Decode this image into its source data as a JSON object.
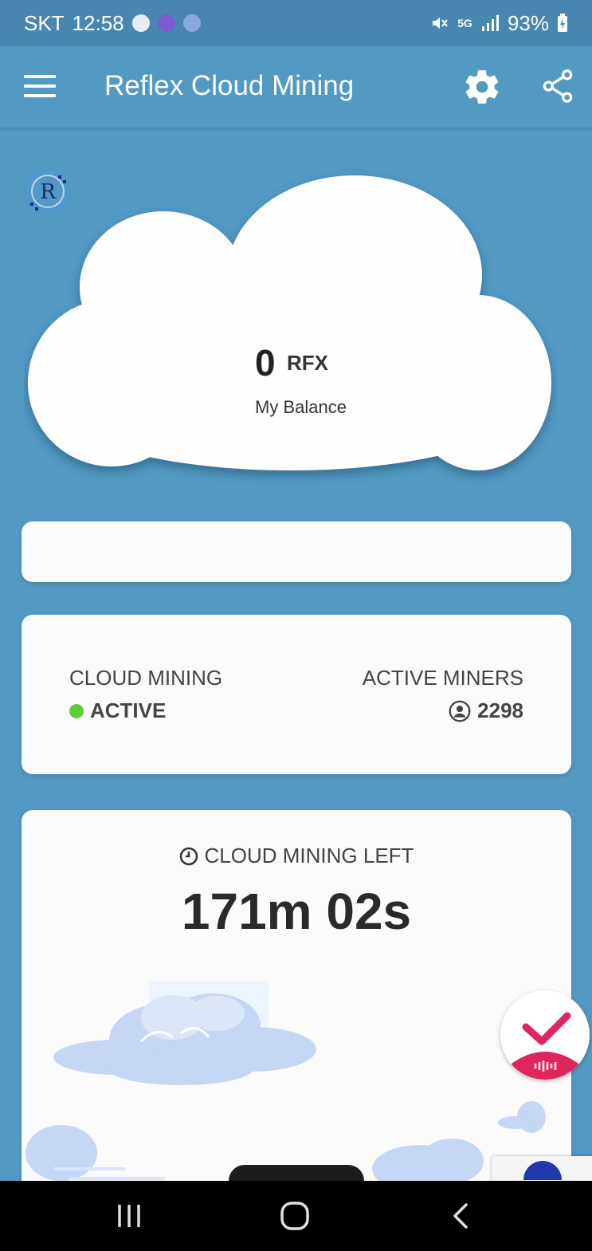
{
  "status_bar": {
    "carrier": "SKT",
    "time": "12:58",
    "battery": "93%",
    "network": "5G"
  },
  "app_bar": {
    "title": "Reflex Cloud Mining"
  },
  "balance": {
    "amount": "0",
    "unit": "RFX",
    "label": "My Balance",
    "logo_letter": "R"
  },
  "mining_status": {
    "cloud_mining_label": "CLOUD MINING",
    "cloud_mining_value": "ACTIVE",
    "active_miners_label": "ACTIVE MINERS",
    "active_miners_value": "2298"
  },
  "timer": {
    "label": "CLOUD MINING LEFT",
    "value": "171m 02s"
  },
  "colors": {
    "background": "#5299c3",
    "status_bar": "#4887b0",
    "active_dot": "#5ecc3e",
    "fab_accent": "#e0245e"
  },
  "icons": {
    "menu": "hamburger-icon",
    "settings": "gear-icon",
    "share": "share-icon",
    "user": "user-circle-icon",
    "clock": "clock-icon",
    "check": "check-icon"
  }
}
